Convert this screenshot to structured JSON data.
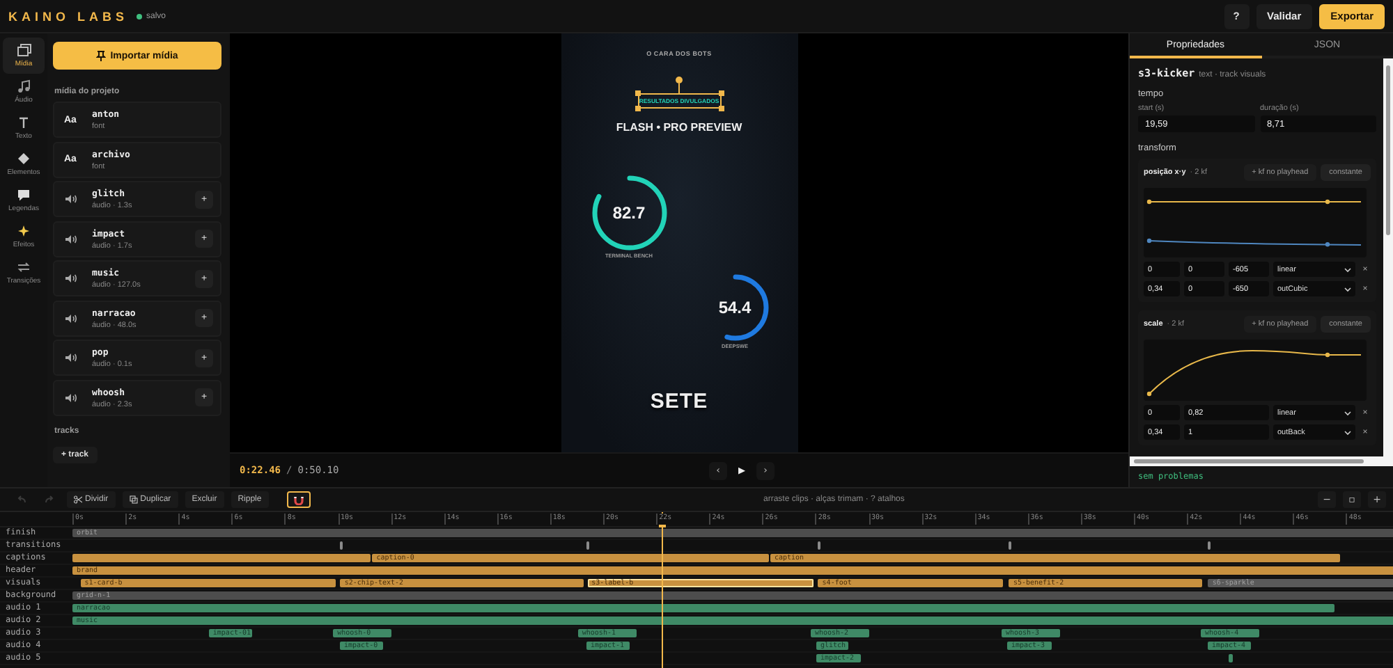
{
  "app": {
    "logo": "KAINO LABS",
    "save_status": "salvo"
  },
  "header_actions": [
    {
      "kind": "help",
      "label": "?"
    },
    {
      "kind": "validate",
      "label": "Validar"
    },
    {
      "kind": "export",
      "label": "Exportar"
    }
  ],
  "rail": [
    {
      "kind": "media",
      "label": "Mídia",
      "selected": true
    },
    {
      "kind": "audio",
      "label": "Áudio",
      "selected": false
    },
    {
      "kind": "text",
      "label": "Texto",
      "selected": false
    },
    {
      "kind": "elements",
      "label": "Elementos",
      "selected": false
    },
    {
      "kind": "captions",
      "label": "Legendas",
      "selected": false
    },
    {
      "kind": "effects",
      "label": "Efeitos",
      "selected": false
    },
    {
      "kind": "transitions",
      "label": "Transições",
      "selected": false
    }
  ],
  "media_panel": {
    "import_button": "Importar mídia",
    "section_title": "mídia do projeto",
    "items": [
      {
        "kind": "font",
        "badge": "Aa",
        "name": "anton",
        "meta": "font"
      },
      {
        "kind": "font",
        "badge": "Aa",
        "name": "archivo",
        "meta": "font"
      },
      {
        "kind": "audio",
        "name": "glitch",
        "meta": "áudio · 1.3s",
        "add": "+"
      },
      {
        "kind": "audio",
        "name": "impact",
        "meta": "áudio · 1.7s",
        "add": "+"
      },
      {
        "kind": "audio",
        "name": "music",
        "meta": "áudio · 127.0s",
        "add": "+"
      },
      {
        "kind": "audio",
        "name": "narracao",
        "meta": "áudio · 48.0s",
        "add": "+"
      },
      {
        "kind": "audio",
        "name": "pop",
        "meta": "áudio · 0.1s",
        "add": "+"
      },
      {
        "kind": "audio",
        "name": "whoosh",
        "meta": "áudio · 2.3s",
        "add": "+"
      }
    ],
    "tracks_title": "tracks",
    "add_track": "+ track"
  },
  "preview": {
    "canvas": {
      "top_label": "O CARA DOS BOTS",
      "kicker": "RESULTADOS DIVULGADOS",
      "title": "FLASH • PRO PREVIEW",
      "gauges": [
        {
          "value": "82.7",
          "label": "TERMINAL BENCH",
          "level": 0.827,
          "color": "#22d3b8"
        },
        {
          "value": "54.4",
          "label": "DEEPSWE",
          "level": 0.544,
          "color": "#1f7ae0"
        }
      ],
      "caption": "SETE"
    },
    "current_time": "0:22.46",
    "separator": "/",
    "total_time": "0:50.10",
    "transport": [
      {
        "kind": "prev",
        "label": "‹"
      },
      {
        "kind": "play",
        "label": "▶"
      },
      {
        "kind": "next",
        "label": "›"
      }
    ]
  },
  "properties": {
    "tabs": [
      {
        "label": "Propriedades",
        "selected": true
      },
      {
        "label": "JSON",
        "selected": false
      }
    ],
    "element_id": "s3-kicker",
    "element_meta": "text · track visuals",
    "tempo": {
      "title": "tempo",
      "fields": [
        {
          "label": "start (s)",
          "value": "19,59"
        },
        {
          "label": "duração (s)",
          "value": "8,71"
        }
      ]
    },
    "transform_title": "transform",
    "animated": [
      {
        "name": "posição x·y",
        "count": "· 2 kf",
        "add_button": "+ kf no playhead",
        "mode_button": "constante",
        "kind": "position",
        "keyframes": [
          {
            "values": [
              "0",
              "0",
              "-605"
            ],
            "easing": "linear",
            "remove": "×"
          },
          {
            "values": [
              "0,34",
              "0",
              "-650"
            ],
            "easing": "outCubic",
            "remove": "×"
          }
        ]
      },
      {
        "name": "scale",
        "count": "· 2 kf",
        "add_button": "+ kf no playhead",
        "mode_button": "constante",
        "kind": "scale",
        "keyframes": [
          {
            "values": [
              "0",
              "0,82"
            ],
            "easing": "linear",
            "remove": "×"
          },
          {
            "values": [
              "0,34",
              "1"
            ],
            "easing": "outBack",
            "remove": "×"
          }
        ]
      }
    ],
    "status": "sem problemas"
  },
  "timeline_toolbar": {
    "history": [
      {
        "kind": "undo",
        "disabled": true
      },
      {
        "kind": "redo",
        "disabled": true
      }
    ],
    "tools": [
      {
        "kind": "split",
        "label": "Dividir"
      },
      {
        "kind": "duplicate",
        "label": "Duplicar"
      },
      {
        "kind": "plain",
        "label": "Excluir"
      },
      {
        "kind": "plain",
        "label": "Ripple"
      }
    ],
    "magnet": {
      "on": true
    },
    "hint": "arraste clips · alças trimam · ? atalhos",
    "zoom": [
      "−",
      "▫",
      "+"
    ]
  },
  "timeline": {
    "ruler": [
      "0s",
      "2s",
      "4s",
      "6s",
      "8s",
      "10s",
      "12s",
      "14s",
      "16s",
      "18s",
      "20s",
      "22s",
      "24s",
      "26s",
      "28s",
      "30s",
      "32s",
      "34s",
      "36s",
      "38s",
      "40s",
      "42s",
      "44s",
      "46s",
      "48s"
    ],
    "playhead": {
      "level": 0.446
    },
    "tracks": [
      {
        "name": "finish",
        "clips": [
          {
            "kind": "clip",
            "label": "orbit",
            "color": "#4d4d4d",
            "selected": false
          }
        ]
      },
      {
        "name": "transitions",
        "clips": [
          {
            "kind": "marker",
            "selected": false
          },
          {
            "kind": "marker",
            "selected": false
          },
          {
            "kind": "marker",
            "selected": false
          },
          {
            "kind": "marker",
            "selected": false
          },
          {
            "kind": "marker",
            "selected": false
          }
        ]
      },
      {
        "name": "captions",
        "clips": [
          {
            "kind": "clip",
            "color": "#c8913f",
            "selected": false
          },
          {
            "kind": "clip",
            "label": "caption-0",
            "color": "#c8913f",
            "selected": false
          },
          {
            "kind": "clip",
            "label": "caption",
            "color": "#c8913f",
            "selected": false
          }
        ]
      },
      {
        "name": "header",
        "clips": [
          {
            "kind": "clip",
            "label": "brand",
            "color": "#c8913f",
            "selected": false
          }
        ]
      },
      {
        "name": "visuals",
        "clips": [
          {
            "kind": "clip",
            "label": "s1-card-b",
            "color": "#c8913f",
            "selected": false
          },
          {
            "kind": "clip",
            "label": "s2-chip-text-2",
            "color": "#c8913f",
            "selected": false
          },
          {
            "kind": "clip",
            "label": "s3-label-b",
            "color": "#c8913f",
            "selected": true
          },
          {
            "kind": "clip",
            "label": "s4-foot",
            "color": "#c8913f",
            "selected": false
          },
          {
            "kind": "clip",
            "label": "s5-benefit-2",
            "color": "#c8913f",
            "selected": false
          },
          {
            "kind": "clip",
            "label": "s6-sparkle",
            "color": "#5a5a5a",
            "selected": false
          }
        ]
      },
      {
        "name": "background",
        "clips": [
          {
            "kind": "clip",
            "label": "grid-n-1",
            "color": "#4d4d4d",
            "selected": false
          }
        ]
      },
      {
        "name": "audio 1",
        "clips": [
          {
            "kind": "clip",
            "label": "narracao",
            "color": "#3f8a66",
            "selected": false
          }
        ]
      },
      {
        "name": "audio 2",
        "clips": [
          {
            "kind": "clip",
            "label": "music",
            "color": "#3f8a66",
            "selected": false
          }
        ]
      },
      {
        "name": "audio 3",
        "clips": [
          {
            "kind": "clip",
            "label": "impact-01",
            "color": "#3f8a66",
            "selected": false
          },
          {
            "kind": "clip",
            "label": "whoosh-0",
            "color": "#3f8a66",
            "selected": false
          },
          {
            "kind": "clip",
            "label": "whoosh-1",
            "color": "#3f8a66",
            "selected": false
          },
          {
            "kind": "clip",
            "label": "whoosh-2",
            "color": "#3f8a66",
            "selected": false
          },
          {
            "kind": "clip",
            "label": "whoosh-3",
            "color": "#3f8a66",
            "selected": false
          },
          {
            "kind": "clip",
            "label": "whoosh-4",
            "color": "#3f8a66",
            "selected": false
          }
        ]
      },
      {
        "name": "audio 4",
        "clips": [
          {
            "kind": "clip",
            "label": "impact-0",
            "color": "#3f8a66",
            "selected": false
          },
          {
            "kind": "clip",
            "label": "impact-1",
            "color": "#3f8a66",
            "selected": false
          },
          {
            "kind": "clip",
            "label": "glitch",
            "color": "#3f8a66",
            "selected": false
          },
          {
            "kind": "clip",
            "label": "impact-3",
            "color": "#3f8a66",
            "selected": false
          },
          {
            "kind": "clip",
            "label": "impact-4",
            "color": "#3f8a66",
            "selected": false
          }
        ]
      },
      {
        "name": "audio 5",
        "clips": [
          {
            "kind": "clip",
            "label": "impact-2",
            "color": "#3f8a66",
            "selected": false
          },
          {
            "kind": "clip",
            "color": "#3f8a66",
            "selected": false
          }
        ]
      }
    ]
  }
}
